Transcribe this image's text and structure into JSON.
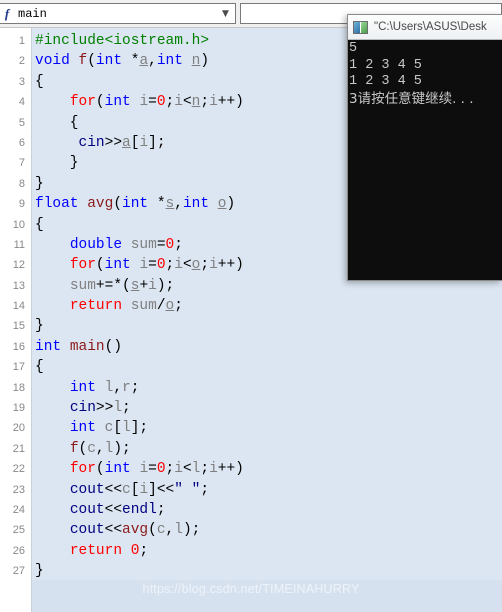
{
  "toolbar": {
    "function_selector": {
      "icon": "function-italic-f-icon",
      "value": "main",
      "arrow_icon": "chevron-down-icon"
    },
    "secondary_selector": {
      "value": "",
      "placeholder": ""
    }
  },
  "editor": {
    "lines": [
      {
        "n": "1",
        "tokens": [
          {
            "t": "#include<iostream.h>",
            "c": "pre"
          }
        ]
      },
      {
        "n": "2",
        "tokens": [
          {
            "t": "void",
            "c": "kw"
          },
          {
            "t": " ",
            "c": "pl"
          },
          {
            "t": "f",
            "c": "fnm"
          },
          {
            "t": "(",
            "c": "pl"
          },
          {
            "t": "int",
            "c": "kw"
          },
          {
            "t": " *",
            "c": "pl"
          },
          {
            "t": "a",
            "c": "var"
          },
          {
            "t": ",",
            "c": "pl"
          },
          {
            "t": "int",
            "c": "kw"
          },
          {
            "t": " ",
            "c": "pl"
          },
          {
            "t": "n",
            "c": "var"
          },
          {
            "t": ")",
            "c": "pl"
          }
        ]
      },
      {
        "n": "3",
        "tokens": [
          {
            "t": "{",
            "c": "pl"
          }
        ]
      },
      {
        "n": "4",
        "tokens": [
          {
            "t": "    ",
            "c": "pl"
          },
          {
            "t": "for",
            "c": "ctl"
          },
          {
            "t": "(",
            "c": "pl"
          },
          {
            "t": "int",
            "c": "kw"
          },
          {
            "t": " ",
            "c": "pl"
          },
          {
            "t": "i",
            "c": "id"
          },
          {
            "t": "=",
            "c": "pl"
          },
          {
            "t": "0",
            "c": "num"
          },
          {
            "t": ";",
            "c": "pl"
          },
          {
            "t": "i",
            "c": "id"
          },
          {
            "t": "<",
            "c": "pl"
          },
          {
            "t": "n",
            "c": "var"
          },
          {
            "t": ";",
            "c": "pl"
          },
          {
            "t": "i",
            "c": "id"
          },
          {
            "t": "++)",
            "c": "pl"
          }
        ]
      },
      {
        "n": "5",
        "tokens": [
          {
            "t": "    {",
            "c": "pl"
          }
        ]
      },
      {
        "n": "6",
        "tokens": [
          {
            "t": "     ",
            "c": "pl"
          },
          {
            "t": "cin",
            "c": "stream"
          },
          {
            "t": ">>",
            "c": "pl"
          },
          {
            "t": "a",
            "c": "var"
          },
          {
            "t": "[",
            "c": "pl"
          },
          {
            "t": "i",
            "c": "id"
          },
          {
            "t": "];",
            "c": "pl"
          }
        ]
      },
      {
        "n": "7",
        "tokens": [
          {
            "t": "    }",
            "c": "pl"
          }
        ]
      },
      {
        "n": "8",
        "tokens": [
          {
            "t": "}",
            "c": "pl"
          }
        ]
      },
      {
        "n": "9",
        "tokens": [
          {
            "t": "float",
            "c": "kw"
          },
          {
            "t": " ",
            "c": "pl"
          },
          {
            "t": "avg",
            "c": "fnm"
          },
          {
            "t": "(",
            "c": "pl"
          },
          {
            "t": "int",
            "c": "kw"
          },
          {
            "t": " *",
            "c": "pl"
          },
          {
            "t": "s",
            "c": "var"
          },
          {
            "t": ",",
            "c": "pl"
          },
          {
            "t": "int",
            "c": "kw"
          },
          {
            "t": " ",
            "c": "pl"
          },
          {
            "t": "o",
            "c": "var"
          },
          {
            "t": ")",
            "c": "pl"
          }
        ]
      },
      {
        "n": "10",
        "tokens": [
          {
            "t": "{",
            "c": "pl"
          }
        ]
      },
      {
        "n": "11",
        "tokens": [
          {
            "t": "    ",
            "c": "pl"
          },
          {
            "t": "double",
            "c": "kw"
          },
          {
            "t": " ",
            "c": "pl"
          },
          {
            "t": "sum",
            "c": "id"
          },
          {
            "t": "=",
            "c": "pl"
          },
          {
            "t": "0",
            "c": "num"
          },
          {
            "t": ";",
            "c": "pl"
          }
        ]
      },
      {
        "n": "12",
        "tokens": [
          {
            "t": "    ",
            "c": "pl"
          },
          {
            "t": "for",
            "c": "ctl"
          },
          {
            "t": "(",
            "c": "pl"
          },
          {
            "t": "int",
            "c": "kw"
          },
          {
            "t": " ",
            "c": "pl"
          },
          {
            "t": "i",
            "c": "id"
          },
          {
            "t": "=",
            "c": "pl"
          },
          {
            "t": "0",
            "c": "num"
          },
          {
            "t": ";",
            "c": "pl"
          },
          {
            "t": "i",
            "c": "id"
          },
          {
            "t": "<",
            "c": "pl"
          },
          {
            "t": "o",
            "c": "var"
          },
          {
            "t": ";",
            "c": "pl"
          },
          {
            "t": "i",
            "c": "id"
          },
          {
            "t": "++)",
            "c": "pl"
          }
        ]
      },
      {
        "n": "13",
        "tokens": [
          {
            "t": "    ",
            "c": "pl"
          },
          {
            "t": "sum",
            "c": "id"
          },
          {
            "t": "+=*(",
            "c": "pl"
          },
          {
            "t": "s",
            "c": "var"
          },
          {
            "t": "+",
            "c": "pl"
          },
          {
            "t": "i",
            "c": "id"
          },
          {
            "t": ");",
            "c": "pl"
          }
        ]
      },
      {
        "n": "14",
        "tokens": [
          {
            "t": "    ",
            "c": "pl"
          },
          {
            "t": "return",
            "c": "ctl"
          },
          {
            "t": " ",
            "c": "pl"
          },
          {
            "t": "sum",
            "c": "id"
          },
          {
            "t": "/",
            "c": "pl"
          },
          {
            "t": "o",
            "c": "var"
          },
          {
            "t": ";",
            "c": "pl"
          }
        ]
      },
      {
        "n": "15",
        "tokens": [
          {
            "t": "}",
            "c": "pl"
          }
        ]
      },
      {
        "n": "16",
        "tokens": [
          {
            "t": "int",
            "c": "kw"
          },
          {
            "t": " ",
            "c": "pl"
          },
          {
            "t": "main",
            "c": "fnm"
          },
          {
            "t": "()",
            "c": "pl"
          }
        ]
      },
      {
        "n": "17",
        "tokens": [
          {
            "t": "{",
            "c": "pl"
          }
        ]
      },
      {
        "n": "18",
        "tokens": [
          {
            "t": "    ",
            "c": "pl"
          },
          {
            "t": "int",
            "c": "kw"
          },
          {
            "t": " ",
            "c": "pl"
          },
          {
            "t": "l",
            "c": "id"
          },
          {
            "t": ",",
            "c": "pl"
          },
          {
            "t": "r",
            "c": "id"
          },
          {
            "t": ";",
            "c": "pl"
          }
        ]
      },
      {
        "n": "19",
        "tokens": [
          {
            "t": "    ",
            "c": "pl"
          },
          {
            "t": "cin",
            "c": "stream"
          },
          {
            "t": ">>",
            "c": "pl"
          },
          {
            "t": "l",
            "c": "id"
          },
          {
            "t": ";",
            "c": "pl"
          }
        ]
      },
      {
        "n": "20",
        "tokens": [
          {
            "t": "    ",
            "c": "pl"
          },
          {
            "t": "int",
            "c": "kw"
          },
          {
            "t": " ",
            "c": "pl"
          },
          {
            "t": "c",
            "c": "id"
          },
          {
            "t": "[",
            "c": "pl"
          },
          {
            "t": "l",
            "c": "id"
          },
          {
            "t": "];",
            "c": "pl"
          }
        ]
      },
      {
        "n": "21",
        "tokens": [
          {
            "t": "    ",
            "c": "pl"
          },
          {
            "t": "f",
            "c": "fnm"
          },
          {
            "t": "(",
            "c": "pl"
          },
          {
            "t": "c",
            "c": "id"
          },
          {
            "t": ",",
            "c": "pl"
          },
          {
            "t": "l",
            "c": "id"
          },
          {
            "t": ");",
            "c": "pl"
          }
        ]
      },
      {
        "n": "22",
        "tokens": [
          {
            "t": "    ",
            "c": "pl"
          },
          {
            "t": "for",
            "c": "ctl"
          },
          {
            "t": "(",
            "c": "pl"
          },
          {
            "t": "int",
            "c": "kw"
          },
          {
            "t": " ",
            "c": "pl"
          },
          {
            "t": "i",
            "c": "id"
          },
          {
            "t": "=",
            "c": "pl"
          },
          {
            "t": "0",
            "c": "num"
          },
          {
            "t": ";",
            "c": "pl"
          },
          {
            "t": "i",
            "c": "id"
          },
          {
            "t": "<",
            "c": "pl"
          },
          {
            "t": "l",
            "c": "id"
          },
          {
            "t": ";",
            "c": "pl"
          },
          {
            "t": "i",
            "c": "id"
          },
          {
            "t": "++)",
            "c": "pl"
          }
        ]
      },
      {
        "n": "23",
        "tokens": [
          {
            "t": "    ",
            "c": "pl"
          },
          {
            "t": "cout",
            "c": "stream"
          },
          {
            "t": "<<",
            "c": "pl"
          },
          {
            "t": "c",
            "c": "id"
          },
          {
            "t": "[",
            "c": "pl"
          },
          {
            "t": "i",
            "c": "id"
          },
          {
            "t": "]<<",
            "c": "pl"
          },
          {
            "t": "\" \"",
            "c": "str"
          },
          {
            "t": ";",
            "c": "pl"
          }
        ]
      },
      {
        "n": "24",
        "tokens": [
          {
            "t": "    ",
            "c": "pl"
          },
          {
            "t": "cout",
            "c": "stream"
          },
          {
            "t": "<<",
            "c": "pl"
          },
          {
            "t": "endl",
            "c": "stream"
          },
          {
            "t": ";",
            "c": "pl"
          }
        ]
      },
      {
        "n": "25",
        "tokens": [
          {
            "t": "    ",
            "c": "pl"
          },
          {
            "t": "cout",
            "c": "stream"
          },
          {
            "t": "<<",
            "c": "pl"
          },
          {
            "t": "avg",
            "c": "fnm"
          },
          {
            "t": "(",
            "c": "pl"
          },
          {
            "t": "c",
            "c": "id"
          },
          {
            "t": ",",
            "c": "pl"
          },
          {
            "t": "l",
            "c": "id"
          },
          {
            "t": ");",
            "c": "pl"
          }
        ]
      },
      {
        "n": "26",
        "tokens": [
          {
            "t": "    ",
            "c": "pl"
          },
          {
            "t": "return",
            "c": "ctl"
          },
          {
            "t": " ",
            "c": "pl"
          },
          {
            "t": "0",
            "c": "num"
          },
          {
            "t": ";",
            "c": "pl"
          }
        ]
      },
      {
        "n": "27",
        "tokens": [
          {
            "t": "}",
            "c": "pl"
          }
        ]
      }
    ]
  },
  "console": {
    "icon": "console-window-icon",
    "title": "\"C:\\Users\\ASUS\\Desk",
    "output_lines": [
      "5",
      "1 2 3 4 5",
      "1 2 3 4 5",
      "3请按任意键继续. . ."
    ]
  },
  "watermark": {
    "text": "https://blog.csdn.net/TIMEINAHURRY"
  },
  "colors": {
    "code_background": "#dce6f2",
    "console_background": "#0d0d0d",
    "console_text": "#c8c8c8",
    "keyword": "#0000ff",
    "preprocessor": "#008000",
    "control": "#ff0000",
    "function_name": "#8b1a1a",
    "string": "#000080",
    "identifier": "#808080"
  }
}
